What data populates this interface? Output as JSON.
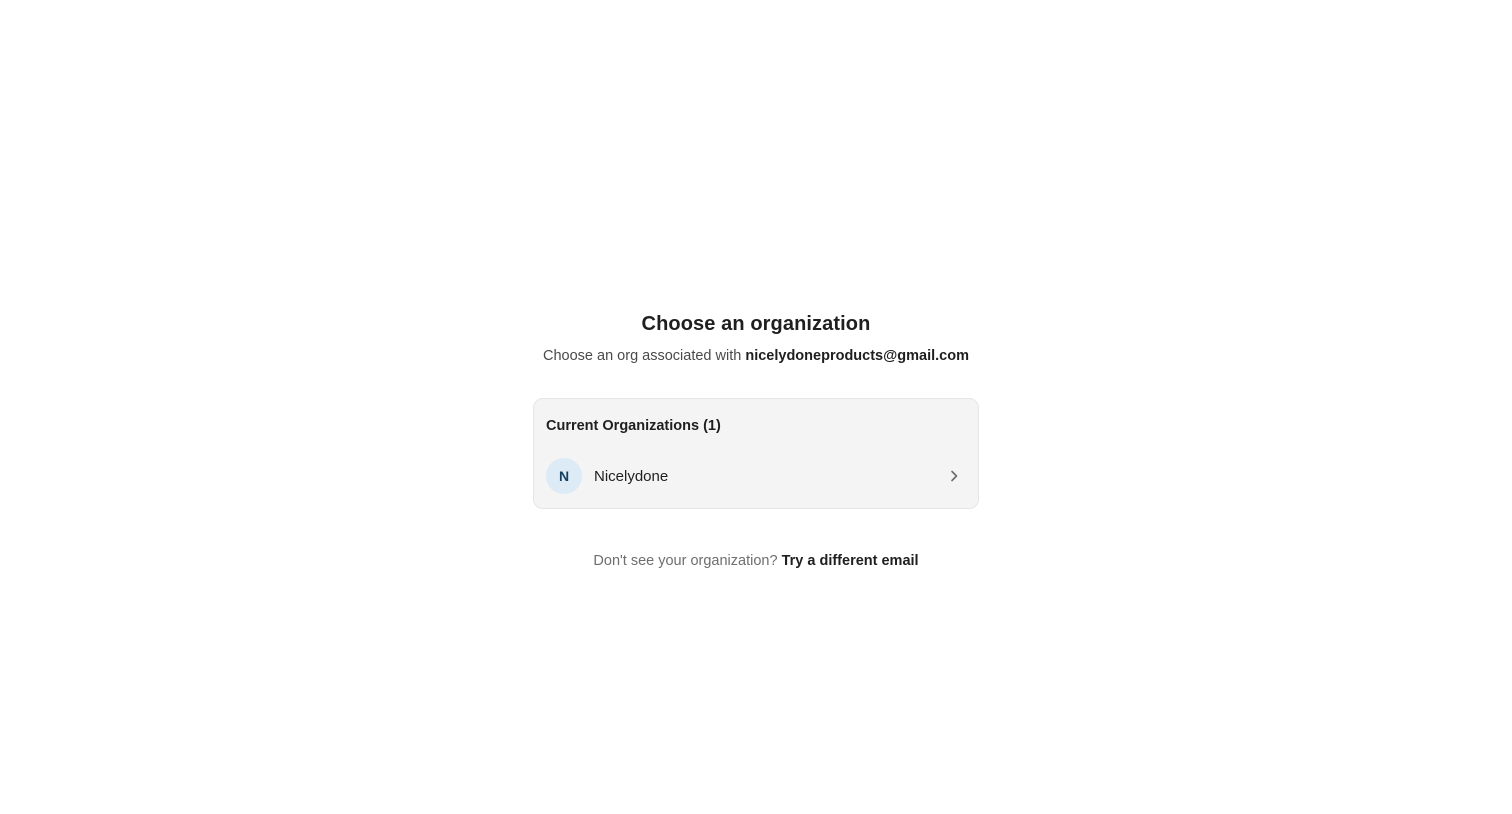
{
  "page": {
    "title": "Choose an organization",
    "subtitle_prefix": "Choose an org associated with",
    "email": "nicelydoneproducts@gmail.com"
  },
  "org_list": {
    "header": "Current Organizations (1)",
    "items": [
      {
        "initial": "N",
        "name": "Nicelydone",
        "icon": "chevron-right-icon"
      }
    ]
  },
  "footer": {
    "prompt": "Don't see your organization?",
    "link_label": "Try a different email"
  },
  "colors": {
    "avatar_bg": "#dcebf6",
    "avatar_text": "#17405f",
    "card_bg": "#f4f4f4"
  }
}
